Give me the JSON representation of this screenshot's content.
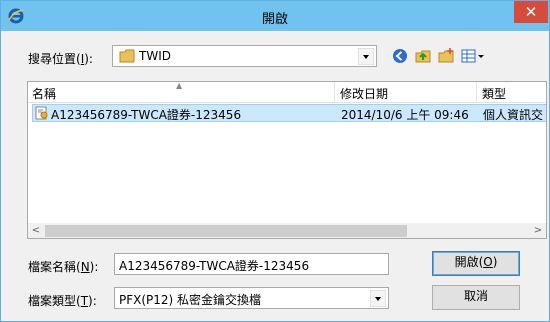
{
  "window": {
    "title": "開啟",
    "close_glyph": "✕",
    "accent": "#6fc3ee"
  },
  "lookin": {
    "label": "搜尋位置(",
    "label_key": "I",
    "label_end": "):",
    "value": "TWID"
  },
  "toolbar": {
    "icons": [
      "back-icon",
      "up-folder-icon",
      "new-folder-icon",
      "view-menu-icon"
    ]
  },
  "columns": {
    "name": "名稱",
    "date": "修改日期",
    "type": "類型"
  },
  "files": [
    {
      "name": "A123456789-TWCA證券-123456",
      "date": "2014/10/6 上午 09:46",
      "type": "個人資訊交"
    }
  ],
  "filename": {
    "label": "檔案名稱(",
    "label_key": "N",
    "label_end": "):",
    "value": "A123456789-TWCA證券-123456"
  },
  "filetype": {
    "label": "檔案類型(",
    "label_key": "T",
    "label_end": "):",
    "value": "PFX(P12) 私密金鑰交換檔"
  },
  "buttons": {
    "open": "開啟(",
    "open_key": "O",
    "open_end": ")",
    "cancel": "取消"
  }
}
